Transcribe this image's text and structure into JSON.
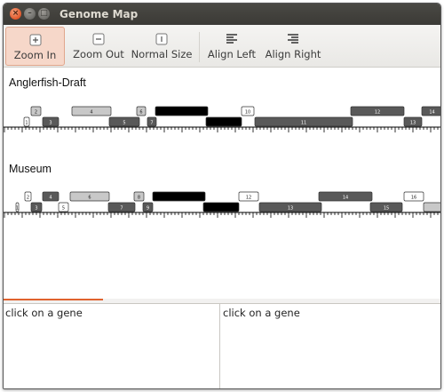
{
  "window": {
    "title": "Genome Map",
    "close_glyph": "×",
    "min_glyph": "–",
    "max_glyph": "□"
  },
  "toolbar": {
    "zoom_in_label": "Zoom In",
    "zoom_out_label": "Zoom Out",
    "normal_size_label": "Normal Size",
    "align_left_label": "Align Left",
    "align_right_label": "Align Right"
  },
  "colors": {
    "accent": "#e0622e",
    "gene_light": "#c8c8c8",
    "gene_mid": "#595959",
    "gene_dark": "#000000",
    "gene_white": "#ffffff"
  },
  "maps": [
    {
      "name": "Anglerfish-Draft",
      "genes": [
        {
          "label": "1",
          "row": "bottom",
          "shade": "white"
        },
        {
          "label": "2",
          "row": "top",
          "shade": "light"
        },
        {
          "label": "3",
          "row": "bottom",
          "shade": "mid"
        },
        {
          "label": "4",
          "row": "top",
          "shade": "light"
        },
        {
          "label": "5",
          "row": "bottom",
          "shade": "mid"
        },
        {
          "label": "6",
          "row": "top",
          "shade": "light"
        },
        {
          "label": "7",
          "row": "bottom",
          "shade": "mid"
        },
        {
          "label": "",
          "row": "top",
          "shade": "dark"
        },
        {
          "label": "",
          "row": "bottom",
          "shade": "dark"
        },
        {
          "label": "10",
          "row": "top",
          "shade": "white"
        },
        {
          "label": "11",
          "row": "bottom",
          "shade": "mid"
        },
        {
          "label": "12",
          "row": "top",
          "shade": "mid"
        },
        {
          "label": "13",
          "row": "bottom",
          "shade": "mid"
        },
        {
          "label": "14",
          "row": "top",
          "shade": "mid"
        }
      ]
    },
    {
      "name": "Museum",
      "genes": [
        {
          "label": "1",
          "row": "bottom",
          "shade": "white"
        },
        {
          "label": "2",
          "row": "top",
          "shade": "white"
        },
        {
          "label": "3",
          "row": "bottom",
          "shade": "mid"
        },
        {
          "label": "4",
          "row": "top",
          "shade": "mid"
        },
        {
          "label": "5",
          "row": "bottom",
          "shade": "white"
        },
        {
          "label": "6",
          "row": "top",
          "shade": "light"
        },
        {
          "label": "7",
          "row": "bottom",
          "shade": "mid"
        },
        {
          "label": "8",
          "row": "top",
          "shade": "light"
        },
        {
          "label": "9",
          "row": "bottom",
          "shade": "mid"
        },
        {
          "label": "",
          "row": "top",
          "shade": "dark"
        },
        {
          "label": "",
          "row": "bottom",
          "shade": "dark"
        },
        {
          "label": "12",
          "row": "top",
          "shade": "white"
        },
        {
          "label": "13",
          "row": "bottom",
          "shade": "mid"
        },
        {
          "label": "14",
          "row": "top",
          "shade": "mid"
        },
        {
          "label": "15",
          "row": "bottom",
          "shade": "mid"
        },
        {
          "label": "16",
          "row": "top",
          "shade": "white"
        },
        {
          "label": "",
          "row": "bottom",
          "shade": "light"
        }
      ]
    }
  ],
  "info_panes": {
    "left_text": "click on a gene",
    "right_text": "click on a gene"
  }
}
